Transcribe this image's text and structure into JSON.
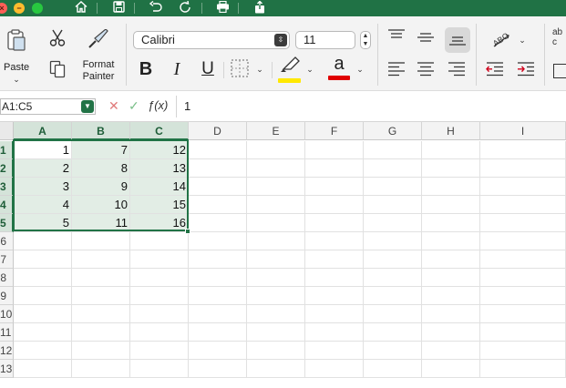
{
  "window": {
    "close_glyph": "×",
    "minimize_glyph": "−"
  },
  "quick_access": [
    {
      "name": "home-icon"
    },
    {
      "name": "save-icon"
    },
    {
      "name": "undo-icon"
    },
    {
      "name": "redo-icon"
    },
    {
      "name": "print-icon"
    },
    {
      "name": "share-icon"
    }
  ],
  "ribbon": {
    "paste_label": "Paste",
    "format_painter_label_1": "Format",
    "format_painter_label_2": "Painter",
    "font_name": "Calibri",
    "font_size": "11",
    "bold_label": "B",
    "italic_label": "I",
    "underline_label": "U",
    "font_color_label": "a",
    "highlight_color": "#ffe800",
    "font_color": "#e00000",
    "wrap_label_partial": "ab\nc"
  },
  "formula_bar": {
    "name_box": "A1:C5",
    "cancel_glyph": "✕",
    "enter_glyph": "✓",
    "fx_label": "ƒ(x)",
    "value": "1"
  },
  "sheet": {
    "columns": [
      "A",
      "B",
      "C",
      "D",
      "E",
      "F",
      "G",
      "H",
      "I"
    ],
    "rows": [
      "1",
      "2",
      "3",
      "4",
      "5",
      "6",
      "7",
      "8",
      "9",
      "10",
      "11",
      "12",
      "13"
    ],
    "cells": [
      [
        "1",
        "7",
        "12"
      ],
      [
        "2",
        "8",
        "13"
      ],
      [
        "3",
        "9",
        "14"
      ],
      [
        "4",
        "10",
        "15"
      ],
      [
        "5",
        "11",
        "16"
      ]
    ],
    "selection": "A1:C5",
    "accent_color": "#217346"
  }
}
